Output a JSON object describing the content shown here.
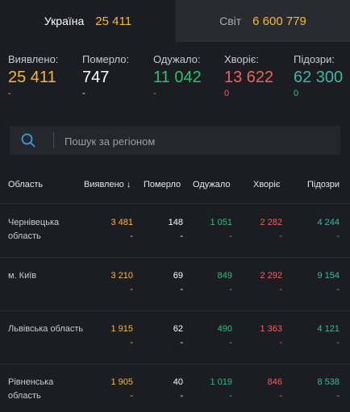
{
  "tabs": {
    "ukraine": {
      "label": "Україна",
      "value": "25 411"
    },
    "world": {
      "label": "Світ",
      "value": "6 600 779"
    }
  },
  "stats": [
    {
      "label": "Виявлено:",
      "value": "25 411",
      "delta": "-",
      "color": "#f5b935"
    },
    {
      "label": "Померло:",
      "value": "747",
      "delta": "-",
      "color": "#ffffff"
    },
    {
      "label": "Одужало:",
      "value": "11 042",
      "delta": "-",
      "color": "#2fbf71"
    },
    {
      "label": "Хворіє:",
      "value": "13 622",
      "delta": "0",
      "color": "#f0605d"
    },
    {
      "label": "Підозри:",
      "value": "62 300",
      "delta": "0",
      "color": "#3bb8a4"
    }
  ],
  "search": {
    "placeholder": "Пошук за регіоном"
  },
  "table": {
    "headers": [
      "Область",
      "Виявлено",
      "Померло",
      "Одужало",
      "Хворіє",
      "Підозри"
    ],
    "sort_indicator": "↓",
    "rows": [
      {
        "region": "Чернівецька область",
        "confirmed": "3 481",
        "deaths": "148",
        "recovered": "1 051",
        "sick": "2 282",
        "suspected": "4 244",
        "d_confirmed": "-",
        "d_deaths": "-",
        "d_recovered": "-",
        "d_sick": "-",
        "d_suspected": "-"
      },
      {
        "region": "м. Київ",
        "confirmed": "3 210",
        "deaths": "69",
        "recovered": "849",
        "sick": "2 292",
        "suspected": "9 154",
        "d_confirmed": "-",
        "d_deaths": "-",
        "d_recovered": "-",
        "d_sick": "-",
        "d_suspected": "-"
      },
      {
        "region": "Львівська область",
        "confirmed": "1 915",
        "deaths": "62",
        "recovered": "490",
        "sick": "1 363",
        "suspected": "4 121",
        "d_confirmed": "-",
        "d_deaths": "-",
        "d_recovered": "-",
        "d_sick": "-",
        "d_suspected": "-"
      },
      {
        "region": "Рівненська область",
        "confirmed": "1 905",
        "deaths": "40",
        "recovered": "1 019",
        "sick": "846",
        "suspected": "8 538",
        "d_confirmed": "-",
        "d_deaths": "-",
        "d_recovered": "-",
        "d_sick": "-",
        "d_suspected": "-"
      }
    ]
  },
  "colors": {
    "confirmed": "#f5b935",
    "deaths": "#ffffff",
    "recovered": "#2fbf71",
    "sick": "#f0605d",
    "suspected": "#3bb8a4",
    "search_icon": "#3a9ad9"
  }
}
